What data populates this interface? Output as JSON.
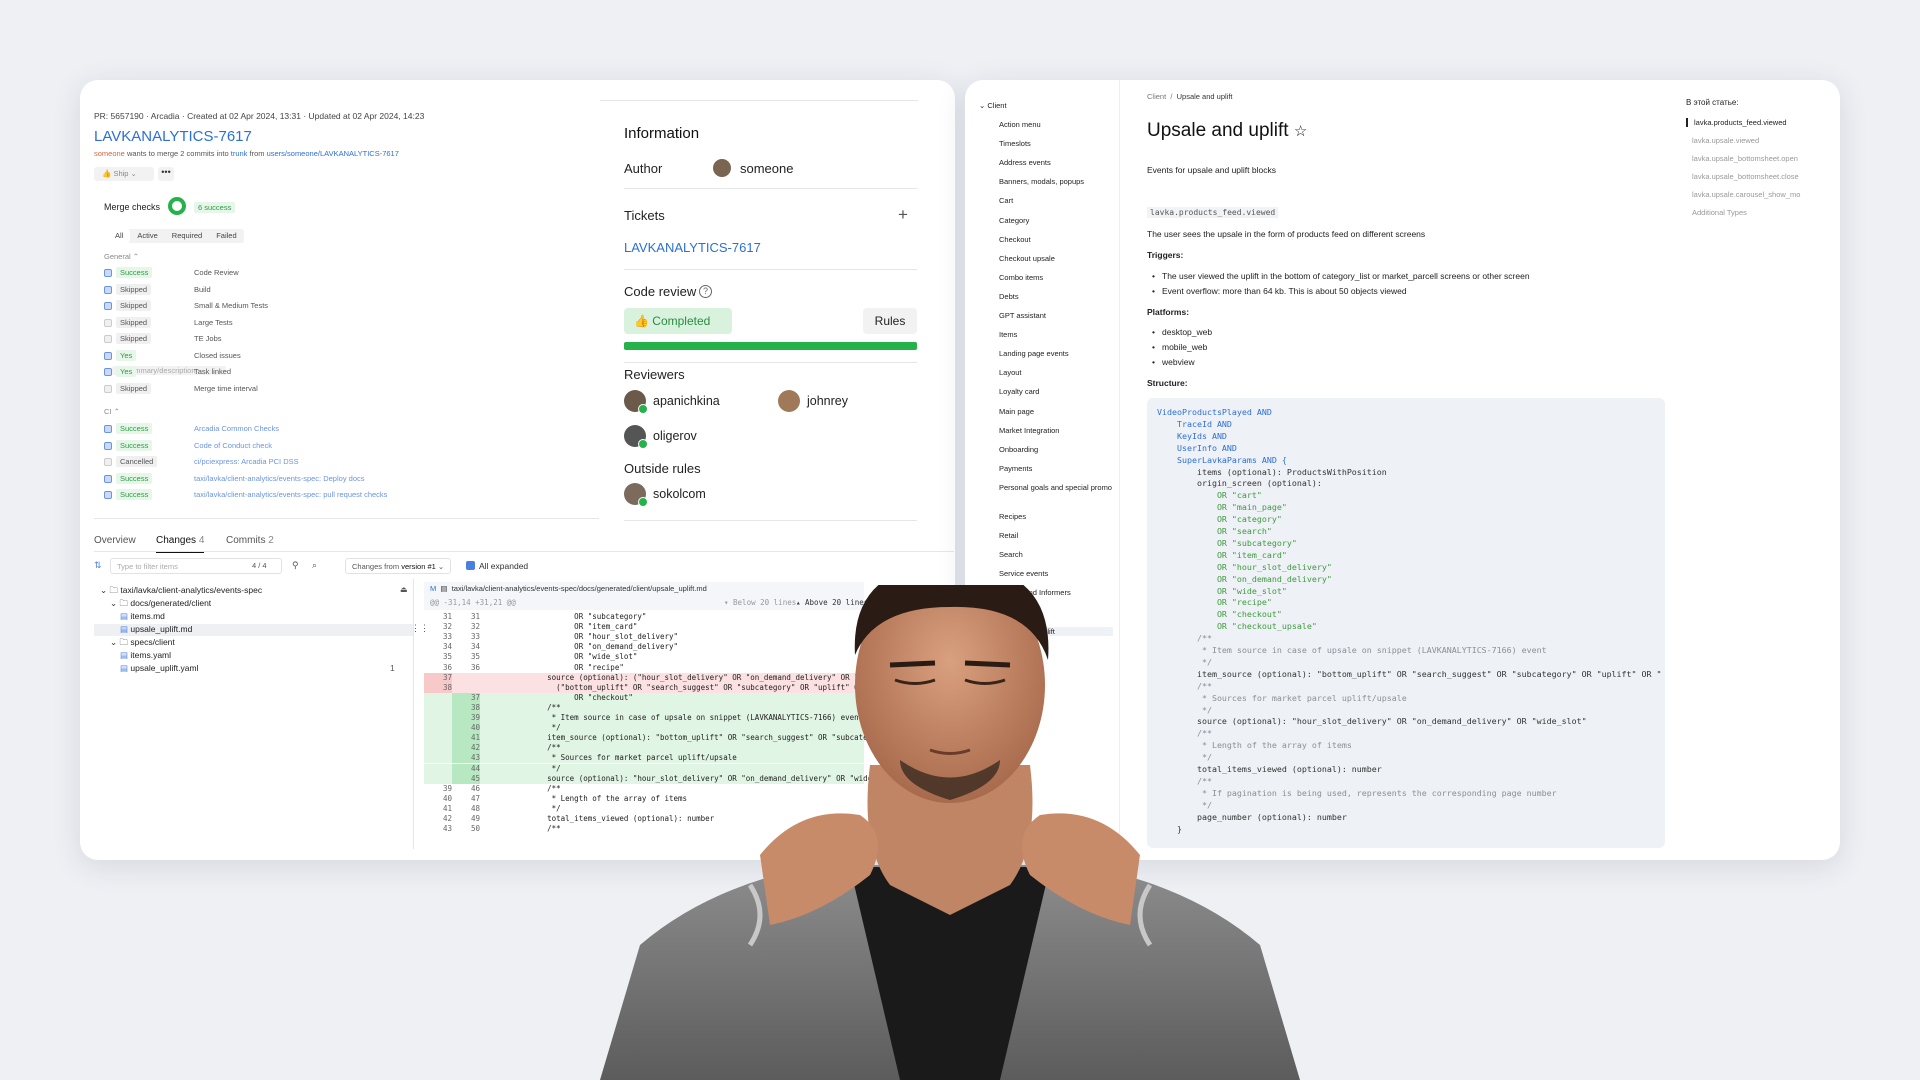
{
  "pr": {
    "meta": "PR: 5657190  ·  Arcadia  ·  Created at 02 Apr 2024, 13:31  ·  Updated at 02 Apr 2024, 14:23",
    "title": "LAVKANALYTICS-7617",
    "sub_user": "someone",
    "sub_text_1": " wants to merge 2 commits into ",
    "sub_branch": "trunk",
    "sub_text_2": " from ",
    "sub_source": "users/someone/LAVKANALYTICS-7617",
    "ship_label": "Ship",
    "more_label": "•••",
    "merge_checks_label": "Merge checks",
    "merge_checks_badge": "6 success",
    "filters": [
      "All",
      "Active",
      "Required",
      "Failed"
    ],
    "group_general": "General",
    "group_ci": "CI",
    "checks_general": [
      {
        "status": "Success",
        "kind": "success",
        "name": "Code Review",
        "checked": true
      },
      {
        "status": "Skipped",
        "kind": "skipped",
        "name": "Build",
        "checked": true
      },
      {
        "status": "Skipped",
        "kind": "skipped",
        "name": "Small & Medium Tests",
        "checked": true
      },
      {
        "status": "Skipped",
        "kind": "skipped",
        "name": "Large Tests",
        "checked": false
      },
      {
        "status": "Skipped",
        "kind": "skipped",
        "name": "TE Jobs",
        "checked": false
      },
      {
        "status": "Yes",
        "kind": "success",
        "name": "Closed issues",
        "checked": true
      },
      {
        "status": "Yes",
        "kind": "success",
        "name": "Task linked",
        "checked": true
      },
      {
        "status": "Skipped",
        "kind": "skipped",
        "name": "Merge time interval",
        "checked": false
      }
    ],
    "task_linked_select": "In summary/description",
    "checks_ci": [
      {
        "status": "Success",
        "kind": "success",
        "name": "Arcadia Common Checks",
        "checked": true
      },
      {
        "status": "Success",
        "kind": "success",
        "name": "Code of Conduct check",
        "checked": true
      },
      {
        "status": "Cancelled",
        "kind": "cancelled",
        "name": "ci/pciexpress: Arcadia PCI DSS",
        "checked": false
      },
      {
        "status": "Success",
        "kind": "success",
        "name": "taxi/lavka/client-analytics/events-spec: Deploy docs",
        "checked": true
      },
      {
        "status": "Success",
        "kind": "success",
        "name": "taxi/lavka/client-analytics/events-spec: pull request checks",
        "checked": true
      }
    ],
    "info": {
      "title": "Information",
      "author_label": "Author",
      "author_name": "someone",
      "tickets_label": "Tickets",
      "ticket": "LAVKANALYTICS-7617",
      "code_review_label": "Code review",
      "help": "?",
      "completed": "Completed",
      "rules": "Rules",
      "progress": 1.0,
      "reviewers_label": "Reviewers",
      "reviewers": [
        "apanichkina",
        "johnrey",
        "oligerov"
      ],
      "outside_rules_label": "Outside rules",
      "outside_reviewer": "sokolcom"
    },
    "tabs": [
      {
        "label": "Overview",
        "count": ""
      },
      {
        "label": "Changes",
        "count": "4"
      },
      {
        "label": "Commits",
        "count": "2"
      }
    ],
    "filter_placeholder": "Type to filter items",
    "filter_count": "4 / 4",
    "changes_from": "Changes from ",
    "changes_version": "version #1",
    "all_expanded": "All expanded",
    "tree": [
      {
        "label": "taxi/lavka/client-analytics/events-spec",
        "type": "folder",
        "depth": 0
      },
      {
        "label": "docs/generated/client",
        "type": "folder",
        "depth": 1
      },
      {
        "label": "items.md",
        "type": "file",
        "depth": 2
      },
      {
        "label": "upsale_uplift.md",
        "type": "file",
        "depth": 2,
        "selected": true
      },
      {
        "label": "specs/client",
        "type": "folder",
        "depth": 1
      },
      {
        "label": "items.yaml",
        "type": "file",
        "depth": 2
      },
      {
        "label": "upsale_uplift.yaml",
        "type": "file",
        "depth": 2,
        "comments": "1"
      }
    ],
    "diff_file": "taxi/lavka/client-analytics/events-spec/docs/generated/client/upsale_uplift.md",
    "diff_file_mark": "M",
    "diff_hunk": "@@ -31,14 +31,21 @@",
    "below_lines": "▾ Below 20 lines",
    "above_lines": "▴ Above 20 lines",
    "diff_lines": [
      {
        "o": "31",
        "n": "31",
        "t": "",
        "c": "            OR \"subcategory\""
      },
      {
        "o": "32",
        "n": "32",
        "t": "",
        "c": "            OR \"item_card\""
      },
      {
        "o": "33",
        "n": "33",
        "t": "",
        "c": "            OR \"hour_slot_delivery\""
      },
      {
        "o": "34",
        "n": "34",
        "t": "",
        "c": "            OR \"on_demand_delivery\""
      },
      {
        "o": "35",
        "n": "35",
        "t": "",
        "c": "            OR \"wide_slot\""
      },
      {
        "o": "36",
        "n": "36",
        "t": "",
        "c": "            OR \"recipe\""
      },
      {
        "o": "37",
        "n": "",
        "t": "del",
        "c": "      source (optional): (\"hour_slot_delivery\" OR \"on_demand_delivery\" OR \"wide_slot\""
      },
      {
        "o": "38",
        "n": "",
        "t": "del",
        "c": "        (\"bottom_uplift\" OR \"search_suggest\" OR \"subcategory\" OR \"uplift\" OR \"upsal"
      },
      {
        "o": "",
        "n": "37",
        "t": "add",
        "c": "            OR \"checkout\""
      },
      {
        "o": "",
        "n": "38",
        "t": "add",
        "c": "      /**"
      },
      {
        "o": "",
        "n": "39",
        "t": "add",
        "c": "       * Item source in case of upsale on snippet (LAVKANALYTICS-7166) event"
      },
      {
        "o": "",
        "n": "40",
        "t": "add",
        "c": "       */"
      },
      {
        "o": "",
        "n": "41",
        "t": "add",
        "c": "      item_source (optional): \"bottom_uplift\" OR \"search_suggest\" OR \"subcategory\""
      },
      {
        "o": "",
        "n": "42",
        "t": "add",
        "c": "      /**"
      },
      {
        "o": "",
        "n": "43",
        "t": "add",
        "c": "       * Sources for market parcel uplift/upsale"
      },
      {
        "o": "",
        "n": "44",
        "t": "add",
        "c": "       */"
      },
      {
        "o": "",
        "n": "45",
        "t": "add",
        "c": "      source (optional): \"hour_slot_delivery\" OR \"on_demand_delivery\" OR \"wide_slo"
      },
      {
        "o": "39",
        "n": "46",
        "t": "",
        "c": "      /**"
      },
      {
        "o": "40",
        "n": "47",
        "t": "",
        "c": "       * Length of the array of items"
      },
      {
        "o": "41",
        "n": "48",
        "t": "",
        "c": "       */"
      },
      {
        "o": "42",
        "n": "49",
        "t": "",
        "c": "      total_items_viewed (optional): number"
      },
      {
        "o": "43",
        "n": "50",
        "t": "",
        "c": "      /**"
      }
    ]
  },
  "docs": {
    "sidebar_root": "Client",
    "sidebar": [
      "Action menu",
      "Timeslots",
      "Address events",
      "Banners, modals, popups",
      "Cart",
      "Category",
      "Checkout",
      "Checkout upsale",
      "Combo items",
      "Debts",
      "GPT assistant",
      "Items",
      "Landing page events",
      "Layout",
      "Loyalty card",
      "Main page",
      "Market Integration",
      "Onboarding",
      "Payments",
      "Personal goals and special promo",
      "Recipes",
      "Retail",
      "Search",
      "Service events",
      "Stories and Informers",
      "Timeslots",
      "Upsale and uplift"
    ],
    "breadcrumb_root": "Client",
    "breadcrumb_sep": "/",
    "breadcrumb_current": "Upsale and uplift",
    "title": "Upsale and uplift",
    "star": "☆",
    "intro": "Events for upsale and uplift blocks",
    "event_name": "lavka.products_feed.viewed",
    "event_desc": "The user sees the upsale in the form of products feed on different screens",
    "triggers_label": "Triggers:",
    "triggers": [
      "The user viewed the uplift in the bottom of category_list or market_parcell screens or other screen",
      "Event overflow: more than 64 kb. This is about 50 objects viewed"
    ],
    "platforms_label": "Platforms:",
    "platforms": [
      "desktop_web",
      "mobile_web",
      "webview"
    ],
    "structure_label": "Structure:",
    "code": [
      "VideoProductsPlayed AND",
      "    TraceId AND",
      "    KeyIds AND",
      "    UserInfo AND",
      "    SuperLavkaParams AND {",
      "        items (optional): ProductsWithPosition",
      "        origin_screen (optional):",
      "            OR \"cart\"",
      "            OR \"main_page\"",
      "            OR \"category\"",
      "            OR \"search\"",
      "            OR \"subcategory\"",
      "            OR \"item_card\"",
      "            OR \"hour_slot_delivery\"",
      "            OR \"on_demand_delivery\"",
      "            OR \"wide_slot\"",
      "            OR \"recipe\"",
      "            OR \"checkout\"",
      "            OR \"checkout_upsale\"",
      "        /**",
      "         * Item source in case of upsale on snippet (LAVKANALYTICS-7166) event",
      "         */",
      "        item_source (optional): \"bottom_uplift\" OR \"search_suggest\" OR \"subcategory\" OR \"uplift\" OR \"",
      "        /**",
      "         * Sources for market parcel uplift/upsale",
      "         */",
      "        source (optional): \"hour_slot_delivery\" OR \"on_demand_delivery\" OR \"wide_slot\"",
      "        /**",
      "         * Length of the array of items",
      "         */",
      "        total_items_viewed (optional): number",
      "        /**",
      "         * If pagination is being used, represents the corresponding page number",
      "         */",
      "        page_number (optional): number",
      "    }"
    ],
    "toc_title": "В этой статье:",
    "toc": [
      "lavka.products_feed.viewed",
      "lavka.upsale.viewed",
      "lavka.upsale_bottomsheet.open",
      "lavka.upsale_bottomsheet.close",
      "lavka.upsale.carousel_show_mo",
      "Additional Types"
    ]
  },
  "colors": {
    "accent": "#2c6fd8",
    "success": "#26b24b",
    "code_bg": "#eef1f6"
  }
}
